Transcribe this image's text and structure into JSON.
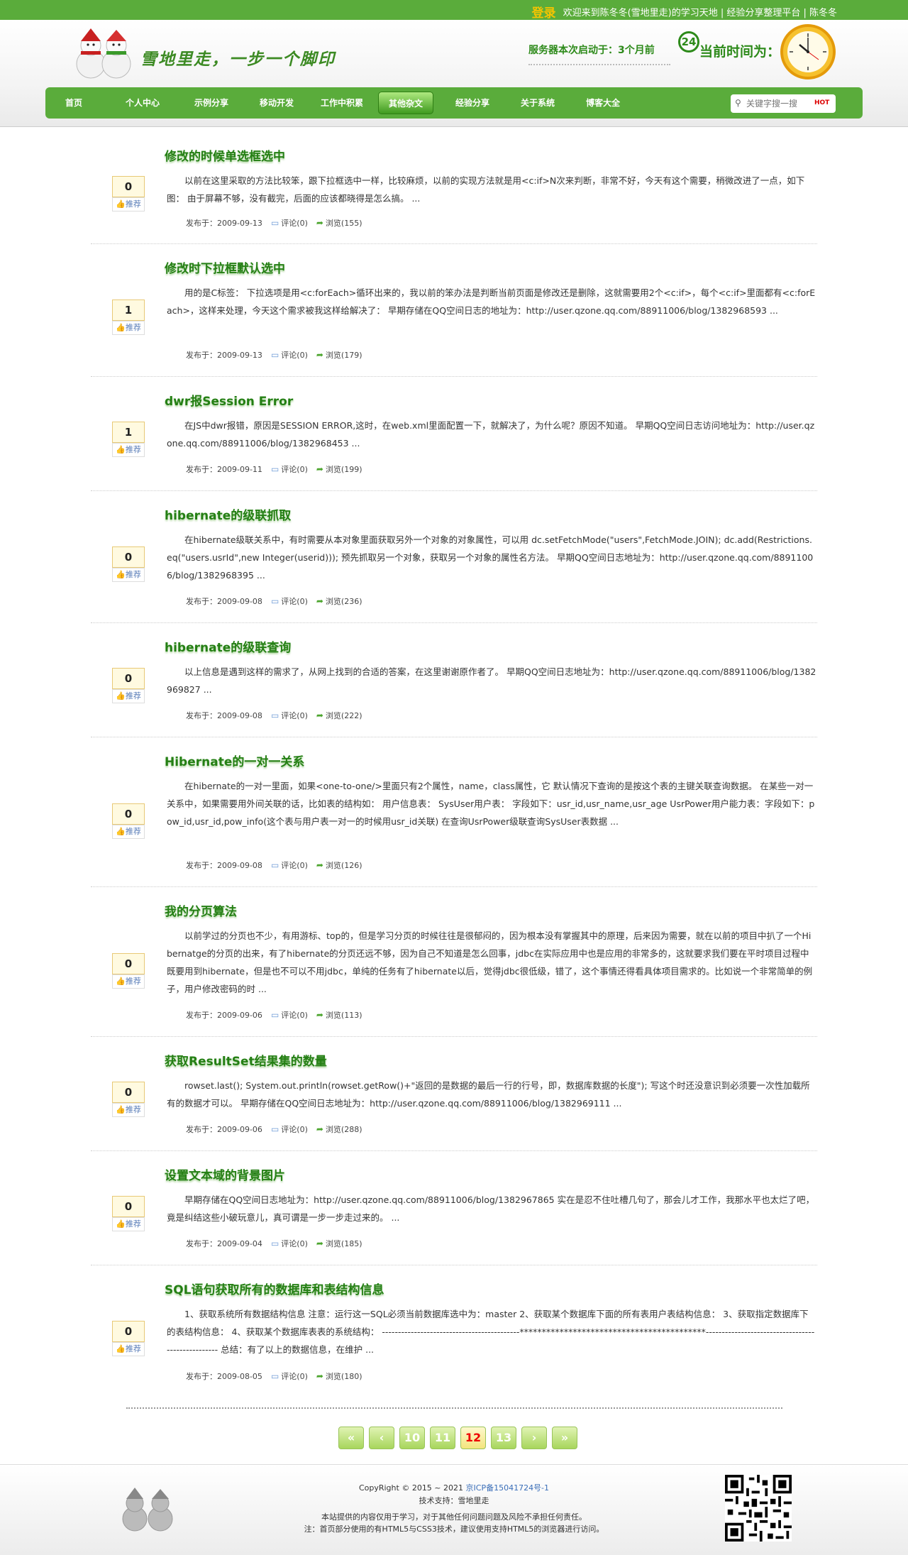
{
  "topbar": {
    "login": "登录",
    "welcome": "欢迎来到陈冬冬(雪地里走)的学习天地 | 经验分享整理平台 | 陈冬冬"
  },
  "header": {
    "logo_text": "雪地里走，一步一个脚印",
    "server_label": "服务器本次启动于：",
    "server_duration": "3个月前",
    "clock_badge": "24",
    "current_time_label": "当前时间为："
  },
  "nav": {
    "items": [
      "首页",
      "个人中心",
      "示例分享",
      "移动开发",
      "工作中积累",
      "其他杂文",
      "经验分享",
      "关于系统",
      "博客大全"
    ],
    "active": "其他杂文"
  },
  "search": {
    "placeholder": "关键字搜一搜",
    "hot": "HOT"
  },
  "posts": [
    {
      "title": "修改的时候单选框选中",
      "desc": "以前在这里采取的方法比较笨，跟下拉框选中一样，比较麻烦，以前的实现方法就是用<c:if>N次来判断，非常不好，今天有这个需要，稍微改进了一点，如下图： 由于屏幕不够，没有截完，后面的应该都晓得是怎么搞。 ...",
      "date": "发布于：2009-09-13",
      "comments": "评论(0)",
      "views": "浏览(155)",
      "votes": "0",
      "recommend": "推荐"
    },
    {
      "title": "修改时下拉框默认选中",
      "desc": "用的是C标签： 下拉选项是用<c:forEach>循环出来的，我以前的笨办法是判断当前页面是修改还是删除，这就需要用2个<c:if>，每个<c:if>里面都有<c:forEach>，这样来处理，今天这个需求被我这样给解决了： 早期存储在QQ空间日志的地址为：http://user.qzone.qq.com/88911006/blog/1382968593 ...",
      "date": "发布于：2009-09-13",
      "comments": "评论(0)",
      "views": "浏览(179)",
      "votes": "1",
      "recommend": "推荐"
    },
    {
      "title": "dwr报Session Error",
      "desc": "在JS中dwr报错，原因是SESSION ERROR,这时，在web.xml里面配置一下，就解决了，为什么呢？原因不知道。 早期QQ空间日志访问地址为：http://user.qzone.qq.com/88911006/blog/1382968453 ...",
      "date": "发布于：2009-09-11",
      "comments": "评论(0)",
      "views": "浏览(199)",
      "votes": "1",
      "recommend": "推荐"
    },
    {
      "title": "hibernate的级联抓取",
      "desc": "在hibernate级联关系中，有时需要从本对象里面获取另外一个对象的对象属性，可以用 dc.setFetchMode(\"users\",FetchMode.JOIN); dc.add(Restrictions.eq(\"users.usrId\",new Integer(userid))); 预先抓取另一个对象，获取另一个对象的属性名方法。 早期QQ空间日志地址为：http://user.qzone.qq.com/88911006/blog/1382968395 ...",
      "date": "发布于：2009-09-08",
      "comments": "评论(0)",
      "views": "浏览(236)",
      "votes": "0",
      "recommend": "推荐"
    },
    {
      "title": "hibernate的级联查询",
      "desc": "以上信息是遇到这样的需求了，从网上找到的合适的答案，在这里谢谢原作者了。 早期QQ空间日志地址为：http://user.qzone.qq.com/88911006/blog/1382969827 ...",
      "date": "发布于：2009-09-08",
      "comments": "评论(0)",
      "views": "浏览(222)",
      "votes": "0",
      "recommend": "推荐"
    },
    {
      "title": "Hibernate的一对一关系",
      "desc": "在hibernate的一对一里面，如果<one-to-one/>里面只有2个属性，name，class属性，它 默认情况下查询的是按这个表的主键关联查询数据。 在某些一对一关系中，如果需要用外间关联的话，比如表的结构如： 用户信息表： SysUser用户表： 字段如下：usr_id,usr_name,usr_age UsrPower用户能力表：字段如下：pow_id,usr_id,pow_info(这个表与用户表一对一的时候用usr_id关联) 在查询UsrPower级联查询SysUser表数据 ...",
      "date": "发布于：2009-09-08",
      "comments": "评论(0)",
      "views": "浏览(126)",
      "votes": "0",
      "recommend": "推荐"
    },
    {
      "title": "我的分页算法",
      "desc": "以前学过的分页也不少，有用游标、top的，但是学习分页的时候往往是很郁闷的，因为根本没有掌握其中的原理，后来因为需要，就在以前的项目中扒了一个Hibernatge的分页的出来，有了hibernate的分页还远不够，因为自己不知道是怎么回事，jdbc在实际应用中也是应用的非常多的，这就要求我们要在平时项目过程中既要用到hibernate，但是也不可以不用jdbc，单纯的任务有了hibernate以后，觉得jdbc很低级，错了，这个事情还得看具体项目需求的。比如说一个非常简单的例子，用户修改密码的时 ...",
      "date": "发布于：2009-09-06",
      "comments": "评论(0)",
      "views": "浏览(113)",
      "votes": "0",
      "recommend": "推荐"
    },
    {
      "title": "获取ResultSet结果集的数量",
      "desc": "rowset.last(); System.out.println(rowset.getRow()+\"返回的是数据的最后一行的行号，即，数据库数据的长度\"); 写这个时还没意识到必须要一次性加载所有的数据才可以。 早期存储在QQ空间日志地址为：http://user.qzone.qq.com/88911006/blog/1382969111 ...",
      "date": "发布于：2009-09-06",
      "comments": "评论(0)",
      "views": "浏览(288)",
      "votes": "0",
      "recommend": "推荐"
    },
    {
      "title": "设置文本域的背景图片",
      "desc": "早期存储在QQ空间日志地址为：http://user.qzone.qq.com/88911006/blog/1382967865 实在是忍不住吐槽几句了，那会儿才工作，我那水平也太烂了吧，竟是纠结这些小破玩意儿，真可谓是一步一步走过来的。 ...",
      "date": "发布于：2009-09-04",
      "comments": "评论(0)",
      "views": "浏览(185)",
      "votes": "0",
      "recommend": "推荐"
    },
    {
      "title": "SQL语句获取所有的数据库和表结构信息",
      "desc": "1、获取系统所有数据结构信息 注意：运行这一SQL必须当前数据库选中为：master 2、获取某个数据库下面的所有表用户表结构信息： 3、获取指定数据库下的表结构信息： 4、获取某个数据库表表的系统结构： -------------------------------------------******************************************-------------------------------------------------- 总结：有了以上的数据信息，在维护 ...",
      "date": "发布于：2009-08-05",
      "comments": "评论(0)",
      "views": "浏览(180)",
      "votes": "0",
      "recommend": "推荐"
    }
  ],
  "pager": {
    "buttons": [
      "«",
      "‹",
      "10",
      "11",
      "12",
      "13",
      "›",
      "»"
    ],
    "current": "12"
  },
  "footer": {
    "copyright": "CopyRight © 2015 ~ 2021",
    "icp": "京ICP备15041724号-1",
    "tech": "技术支持：雪地里走",
    "disclaimer": "本站提供的内容仅用于学习，对于其他任何问题问题及风险不承担任何责任。",
    "note": "注：首页部分使用的有HTML5与CSS3技术，建议使用支持HTML5的浏览器进行访问。"
  }
}
